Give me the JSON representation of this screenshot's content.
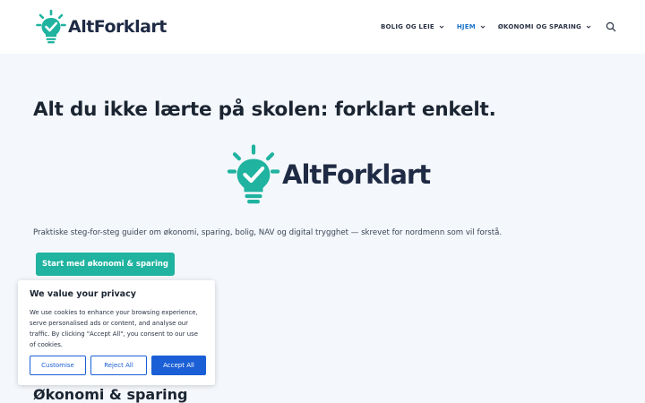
{
  "header": {
    "logo_text": "AltForklart",
    "nav": [
      {
        "label": "BOLIG OG LEIE"
      },
      {
        "label": "HJEM"
      },
      {
        "label": "ØKONOMI OG SPARING"
      }
    ]
  },
  "hero": {
    "title": "Alt du ikke lærte på skolen: forklart enkelt.",
    "logo_text": "AltForklart",
    "tagline": "Praktiske steg-for-steg guider om økonomi, sparing, bolig, NAV og digital trygghet — skrevet for nordmenn som vil forstå.",
    "cta_label": "Start med økonomi & sparing"
  },
  "section": {
    "title": "Økonomi & sparing"
  },
  "cookie_banner": {
    "title": "We value your privacy",
    "text": "We use cookies to enhance your browsing experience, serve personalised ads or content, and analyse our traffic. By clicking \"Accept All\", you consent to our use of cookies.",
    "customise_label": "Customise",
    "reject_label": "Reject All",
    "accept_label": "Accept All"
  },
  "colors": {
    "brand_teal": "#1fb3a0",
    "brand_navy": "#1f2a44",
    "nav_active": "#1a73c7",
    "cookie_blue": "#1a5fd6"
  },
  "icons": [
    "lightbulb-check-icon",
    "chevron-down-icon",
    "search-icon"
  ]
}
